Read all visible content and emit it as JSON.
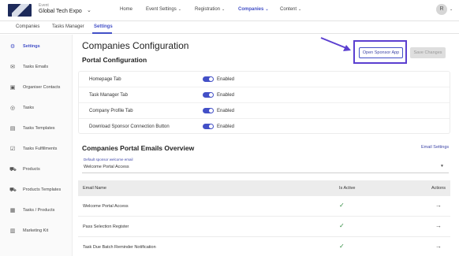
{
  "header": {
    "event_label": "Event",
    "event_name": "Global Tech Expo",
    "nav": [
      {
        "label": "Home",
        "has_menu": false,
        "active": false
      },
      {
        "label": "Event Settings",
        "has_menu": true,
        "active": false
      },
      {
        "label": "Registration",
        "has_menu": true,
        "active": false
      },
      {
        "label": "Companies",
        "has_menu": true,
        "active": true
      },
      {
        "label": "Content",
        "has_menu": true,
        "active": false
      }
    ],
    "avatar_initial": "R"
  },
  "subtabs": [
    "Companies",
    "Tasks Manager",
    "Settings"
  ],
  "sidebar": {
    "items": [
      {
        "label": "Settings",
        "icon": "gear-icon"
      },
      {
        "label": "Tasks Emails",
        "icon": "mail-icon"
      },
      {
        "label": "Organiser Contacts",
        "icon": "contact-icon"
      },
      {
        "label": "Tasks",
        "icon": "check-circle-icon"
      },
      {
        "label": "Tasks Templates",
        "icon": "document-icon"
      },
      {
        "label": "Tasks Fulfillments",
        "icon": "checkbox-icon"
      },
      {
        "label": "Products",
        "icon": "cart-icon"
      },
      {
        "label": "Products Templates",
        "icon": "cart-template-icon"
      },
      {
        "label": "Tasks / Products",
        "icon": "box-icon"
      },
      {
        "label": "Marketing Kit",
        "icon": "kit-icon"
      }
    ]
  },
  "main": {
    "title": "Companies Configuration",
    "portal_section_title": "Portal Configuration",
    "open_sponsor_label": "Open Sponsor App",
    "save_label": "Save Changes",
    "config_rows": [
      {
        "label": "Homepage Tab",
        "state": "Enabled"
      },
      {
        "label": "Task Manager Tab",
        "state": "Enabled"
      },
      {
        "label": "Company Profile Tab",
        "state": "Enabled"
      },
      {
        "label": "Download Sponsor Connection Button",
        "state": "Enabled"
      }
    ],
    "emails_title": "Companies Portal Emails Overview",
    "email_settings_label": "Email Settings",
    "select": {
      "label": "Default sponsor welcome email",
      "value": "Welcome Portal Access"
    },
    "table": {
      "headers": [
        "Email Name",
        "Is Active",
        "Actions"
      ],
      "rows": [
        {
          "name": "Welcome Portal Access",
          "active": "✓",
          "action": "→"
        },
        {
          "name": "Pass Selection Register",
          "active": "✓",
          "action": "→"
        },
        {
          "name": "Task Due Batch Reminder Notification",
          "active": "✓",
          "action": "→"
        }
      ]
    }
  },
  "colors": {
    "accent": "#4350c7",
    "highlight": "#5b3fd0",
    "check": "#2e8b3e"
  }
}
